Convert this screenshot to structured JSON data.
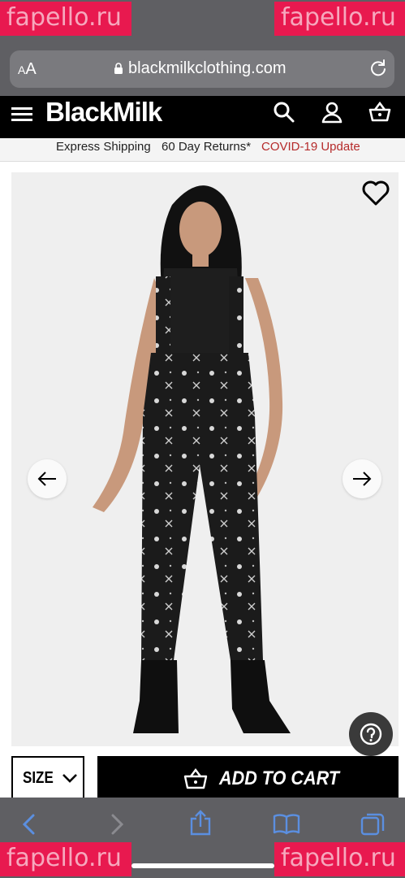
{
  "watermark": "fapello.ru",
  "browser": {
    "text_size_label": "AA",
    "url": "blackmilkclothing.com"
  },
  "site": {
    "logo": "BlackMilk",
    "promo": [
      "Express Shipping",
      "60 Day Returns*",
      "COVID-19 Update"
    ],
    "colors": {
      "covid_link": "#b52a2a",
      "header_bg": "#000000"
    }
  },
  "product": {
    "size_label": "SIZE",
    "add_to_cart_label": "ADD TO CART"
  },
  "icons": [
    "menu-icon",
    "search-icon",
    "account-icon",
    "cart-icon",
    "heart-icon",
    "arrow-left-icon",
    "arrow-right-icon",
    "help-icon",
    "back-icon",
    "forward-icon",
    "share-icon",
    "bookmarks-icon",
    "tabs-icon"
  ]
}
